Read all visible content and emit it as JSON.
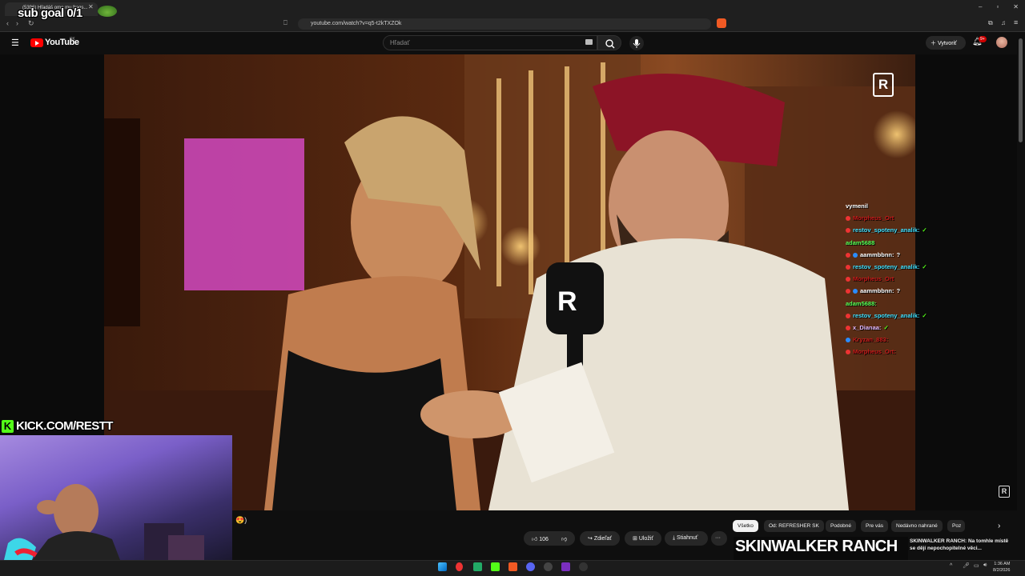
{
  "browser": {
    "tab_title": "(5396) Hľadáš ome mu frags...",
    "url": "youtube.com/watch?v=q5-t2kTXZOk",
    "window_controls": [
      "–",
      "▫",
      "✕"
    ]
  },
  "overlay": {
    "sub_goal": "sub goal 0/1",
    "kick_text": "KICK.COM/RESTT",
    "kick_logo": "K"
  },
  "youtube": {
    "logo_text": "YouTube",
    "region": "SK",
    "search_placeholder": "Hľadať",
    "create_label": "Vytvoriť",
    "notif_count": "9+",
    "brand_mark": "R"
  },
  "chat": {
    "messages": [
      {
        "user": "vymenil",
        "text": "",
        "color": "#ffffff",
        "badge": ""
      },
      {
        "user": "Morpheus_Ort",
        "text": "",
        "color": "#c81a1a",
        "badge": "red"
      },
      {
        "user": "restov_spoteny_analik:",
        "text": "✓",
        "color": "#3fe0ff",
        "badge": "red"
      },
      {
        "user": "adam5688",
        "text": "",
        "color": "#55ff55",
        "badge": ""
      },
      {
        "user": "aammbbnn:",
        "text": "?",
        "color": "#ffffff",
        "badge": "red-blue"
      },
      {
        "user": "restov_spoteny_analik:",
        "text": "✓",
        "color": "#3fe0ff",
        "badge": "red"
      },
      {
        "user": "Morpheus_Ort",
        "text": "",
        "color": "#c81a1a",
        "badge": "red"
      },
      {
        "user": "aammbbnn:",
        "text": "?",
        "color": "#ffffff",
        "badge": "red-blue"
      },
      {
        "user": "adam5688:",
        "text": "",
        "color": "#55ff55",
        "badge": ""
      },
      {
        "user": "restov_spoteny_analik:",
        "text": "✓",
        "color": "#3fe0ff",
        "badge": "red"
      },
      {
        "user": "x_Dianaa:",
        "text": "✓",
        "color": "#e0b8ff",
        "badge": "red"
      },
      {
        "user": "Kryzan_883:",
        "text": "",
        "color": "#c81a1a",
        "badge": "blue"
      },
      {
        "user": "Morpheus_Ort:",
        "text": "",
        "color": "#c81a1a",
        "badge": "red"
      }
    ]
  },
  "below_video": {
    "emoji_text": "😍)",
    "likes": "106",
    "share_label": "Zdieľať",
    "save_label": "Uložiť",
    "download_label": "Stiahnuť",
    "more_label": "···"
  },
  "chips": [
    "Všetko",
    "Od: REFRESHER SK",
    "Podobné",
    "Pre vás",
    "Nedávno nahrané",
    "Poz"
  ],
  "recommendation": {
    "thumb_text": "SKINWALKER RANCH",
    "title": "SKINWALKER RANCH: Na tomhle místě se dějí nepochopitelné věci..."
  },
  "taskbar": {
    "time": "1:36 AM",
    "date": "8/2/2026"
  }
}
